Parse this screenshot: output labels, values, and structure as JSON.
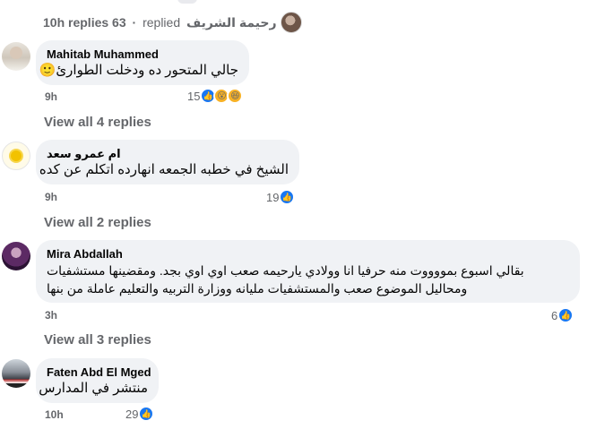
{
  "top_thread": {
    "time": "10h",
    "replies_label": "replies",
    "replies_count": "63",
    "separator": "·",
    "replied_label": "replied",
    "replier_name": "رحيمة الشريف"
  },
  "comments": [
    {
      "author": "Mahitab Muhammed",
      "lines": [
        "جالي المتحور ده ودخلت الطوارئ🙂"
      ],
      "time": "9h",
      "reaction_count": "15",
      "reactions": [
        "like-icon",
        "wow-icon",
        "haha-icon"
      ],
      "view_replies": "View all 4 replies"
    },
    {
      "author": "ام عمرو سعد",
      "lines": [
        "الشيخ في خطبه الجمعه انهارده اتكلم عن كده"
      ],
      "time": "9h",
      "reaction_count": "19",
      "reactions": [
        "like-icon"
      ],
      "view_replies": "View all 2 replies"
    },
    {
      "author": "Mira Abdallah",
      "lines": [
        "بقالي اسبوع بمووووت منه حرفيا انا وولادي يارحيمه صعب اوي اوي بجد. ومقضينها مستشفيات",
        "ومحاليل الموضوع صعب والمستشفيات مليانه ووزارة التربيه والتعليم عاملة من بنها"
      ],
      "time": "3h",
      "reaction_count": "6",
      "reactions": [
        "like-icon"
      ],
      "view_replies": "View all 3 replies"
    },
    {
      "author": "Faten Abd El Mged",
      "lines": [
        "منتشر في المدارس"
      ],
      "time": "10h",
      "reaction_count": "29",
      "reactions": [
        "like-icon"
      ]
    }
  ],
  "colors": {
    "bubble": "#f0f2f5",
    "meta_text": "#65676b",
    "like_blue": "#1877f2",
    "emoji_yellow": "#f7b125"
  }
}
